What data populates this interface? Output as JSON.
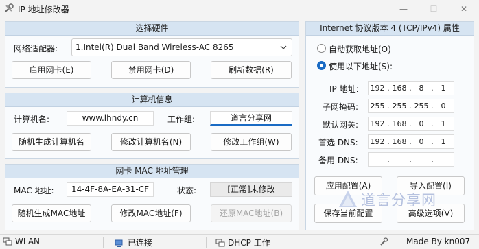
{
  "window": {
    "title": "IP 地址修改器",
    "minimize": "—",
    "maximize": "☐",
    "close": "✕"
  },
  "hardware": {
    "header": "选择硬件",
    "adapter_label": "网络适配器:",
    "adapter_value": "1.Intel(R) Dual Band Wireless-AC 8265",
    "enable_button": "启用网卡(E)",
    "disable_button": "禁用网卡(D)",
    "refresh_button": "刷新数据(R)"
  },
  "computer": {
    "header": "计算机信息",
    "name_label": "计算机名:",
    "name_value": "www.lhndy.cn",
    "workgroup_label": "工作组:",
    "workgroup_value": "道言分享网",
    "random_name_button": "随机生成计算机名",
    "modify_name_button": "修改计算机名(N)",
    "modify_workgroup_button": "修改工作组(W)"
  },
  "mac": {
    "header": "网卡 MAC 地址管理",
    "mac_label": "MAC 地址:",
    "mac_value": "14-4F-8A-EA-31-CF",
    "status_label": "状态:",
    "status_value": "[正常]未修改",
    "random_mac_button": "随机生成MAC地址",
    "modify_mac_button": "修改MAC地址(F)",
    "restore_mac_button": "还原MAC地址(B)"
  },
  "ipv4": {
    "header": "Internet 协议版本 4 (TCP/IPv4) 属性",
    "auto_label": "自动获取地址(O)",
    "manual_label": "使用以下地址(S):",
    "selected": "manual",
    "ip_label": "IP 地址:",
    "ip": [
      "192",
      "168",
      "8",
      "1"
    ],
    "mask_label": "子网掩码:",
    "mask": [
      "255",
      "255",
      "255",
      "0"
    ],
    "gateway_label": "默认网关:",
    "gateway": [
      "192",
      "168",
      "0",
      "1"
    ],
    "dns1_label": "首选 DNS:",
    "dns1": [
      "192",
      "168",
      "0",
      "1"
    ],
    "dns2_label": "备用 DNS:",
    "dns2": [
      "",
      "",
      "",
      ""
    ],
    "apply_button": "应用配置(A)",
    "import_button": "导入配置(I)",
    "save_button": "保存当前配置",
    "advanced_button": "高级选项(V)"
  },
  "watermark": {
    "text": "道言分享网"
  },
  "statusbar": {
    "adapter_type": "WLAN",
    "connection": "已连接",
    "dhcp": "DHCP 工作",
    "author": "Made By kn007"
  },
  "colors": {
    "accent": "#1a6bc4",
    "group_header": "#d6e4f2",
    "disabled_text": "#a6a6a6"
  }
}
